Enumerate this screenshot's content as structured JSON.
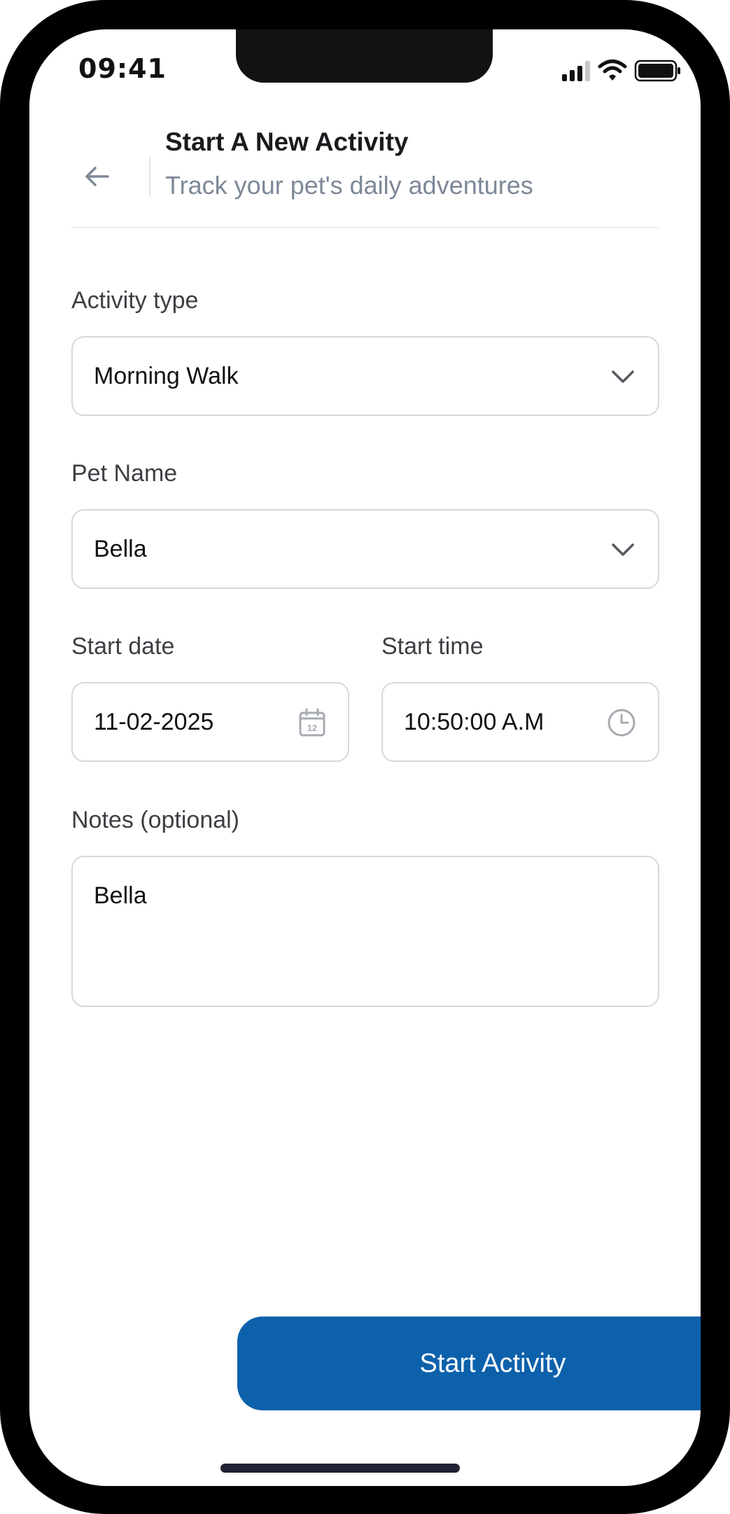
{
  "status_bar": {
    "time": "09:41",
    "icons": [
      "cellular-signal-icon",
      "wifi-icon",
      "battery-icon"
    ]
  },
  "header": {
    "back_icon": "arrow-left-icon",
    "title": "Start A New Activity",
    "subtitle": "Track your pet's daily adventures"
  },
  "form": {
    "activity_type": {
      "label": "Activity type",
      "value": "Morning Walk",
      "icon": "chevron-down-icon"
    },
    "pet_name": {
      "label": "Pet Name",
      "value": "Bella",
      "icon": "chevron-down-icon"
    },
    "start_date": {
      "label": "Start date",
      "value": "11-02-2025",
      "icon": "calendar-icon",
      "icon_text": "12"
    },
    "start_time": {
      "label": "Start time",
      "value": "10:50:00 A.M",
      "icon": "clock-icon"
    },
    "notes": {
      "label": "Notes (optional)",
      "value": "Bella"
    }
  },
  "actions": {
    "start_label": "Start Activity"
  },
  "colors": {
    "primary": "#0d61ab",
    "text": "#121212",
    "muted": "#7d8898",
    "border": "#d5d8dd"
  }
}
